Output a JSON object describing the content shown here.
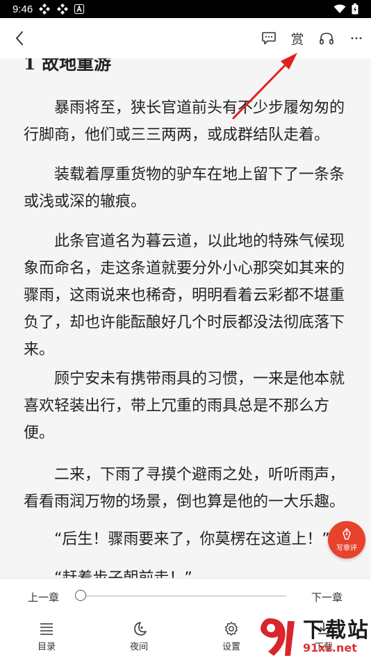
{
  "status_bar": {
    "time": "9:46"
  },
  "toolbar": {
    "reward_label": "赏"
  },
  "book": {
    "chapter_title": "1 故地重游",
    "paragraphs": [
      "暴雨将至，狭长官道前头有不少步履匆匆的行脚商，他们或三三两两，或成群结队走着。",
      "装载着厚重货物的驴车在地上留下了一条条或浅或深的辙痕。",
      "此条官道名为暮云道，以此地的特殊气候现象而命名，走这条道就要分外小心那突如其来的骤雨，这雨说来也稀奇，明明看着云彩都不堪重负了，却也许能酝酿好几个时辰都没法彻底落下来。",
      "顾宁安未有携带雨具的习惯，一来是他本就喜欢轻装出行，带上冗重的雨具总是不那么方便。",
      "二来，下雨了寻摸个避雨之处，听听雨声，看看雨润万物的场景，倒也算是他的一大乐趣。",
      "“后生！骤雨要来了，你莫楞在这道上！”",
      "“赶着步子朝前走！”"
    ]
  },
  "write_comment": {
    "label": "写章评"
  },
  "progress": {
    "prev_label": "上一章",
    "next_label": "下一章",
    "value": 0.0
  },
  "bottom_nav": {
    "items": [
      {
        "label": "目录",
        "icon": "list-icon"
      },
      {
        "label": "夜间",
        "icon": "moon-icon"
      },
      {
        "label": "设置",
        "icon": "gear-icon"
      },
      {
        "label": "下载",
        "icon": "download-icon"
      }
    ]
  },
  "watermark": {
    "title": "下载站",
    "url": "91xz.net"
  },
  "colors": {
    "accent": "#e8412c",
    "text": "#222222",
    "background": "#f5f5f5",
    "annotation_arrow": "#e0201a"
  }
}
